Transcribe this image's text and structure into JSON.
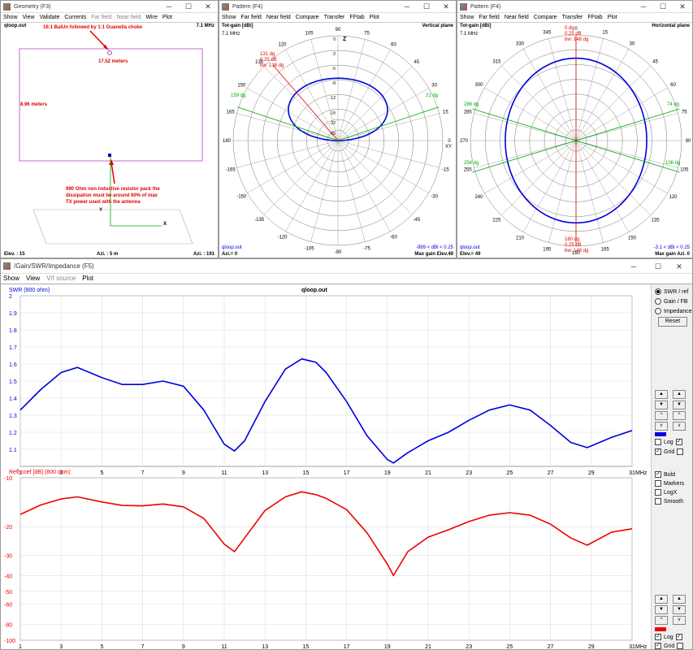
{
  "geom": {
    "title": "Geometry   (F3)",
    "menu": [
      "Show",
      "View",
      "Validate",
      "Currents",
      "Far field",
      "Near field",
      "Wire",
      "Plot"
    ],
    "file": "qloop.out",
    "freq": "7.1 MHz",
    "balun": "16:1 BalUn followed by 1:1 Guanella choke",
    "width": "17.52 meters",
    "height": "8.96 meters",
    "note1": "990 Ohm non inductive resistor pack the",
    "note2": "dissipation must be around 60% of max",
    "note3": "TX power used with the antenna",
    "elev": "Elev. : 15",
    "azi_mid": "Azi. : 5 m",
    "azi": "Azi. : 191",
    "ax_y": "Y",
    "ax_x": "X",
    "ax_z": "Z"
  },
  "pv": {
    "title": "Pattern   (F4)",
    "menu": [
      "Show",
      "Far field",
      "Near field",
      "Compare",
      "Transfer",
      "FFtab",
      "Plot"
    ],
    "gain": "Tot-gain [dBi]",
    "freq": "7.1 MHz",
    "plane": "Vertical plane",
    "file": "qloop.out",
    "azi": "Azi.= 0",
    "range": "-999 < dBi < 0.25",
    "maxg": "Max gain Elev.49",
    "zl": "Z",
    "xy": "XY",
    "ang": [
      "90",
      "60",
      "30",
      "0",
      "-30",
      "-60",
      "-90",
      "-120",
      "-150",
      "180",
      "150",
      "120"
    ],
    "ang2": [
      "75",
      "45",
      "15",
      "-15",
      "-45",
      "-75",
      "-105",
      "-135",
      "-165",
      "165",
      "135",
      "105"
    ],
    "lab1": "131 dg",
    "lab2": "0.25 dB",
    "lab3": "bw: 138 dg",
    "lab4": "159 dg",
    "lab5": "21 dg",
    "rings": [
      "0",
      "-2",
      "-5",
      "-8",
      "-12",
      "-16",
      "-22",
      "-35"
    ]
  },
  "ph": {
    "title": "Pattern   (F4)",
    "menu": [
      "Show",
      "Far field",
      "Near field",
      "Compare",
      "Transfer",
      "FFtab",
      "Plot"
    ],
    "gain": "Tot-gain [dBi]",
    "freq": "7.1 MHz",
    "plane": "Horizontal plane",
    "file": "qloop.out",
    "elev": "Elev.= 49",
    "range": "-3.1 < dBi < 0.25",
    "maxg": "Max gain Azi. 0",
    "ang": [
      "0",
      "30",
      "60",
      "90",
      "120",
      "150",
      "180",
      "210",
      "240",
      "270",
      "300",
      "330"
    ],
    "ang2": [
      "15",
      "45",
      "75",
      "105",
      "135",
      "165",
      "195",
      "225",
      "255",
      "285",
      "315",
      "345"
    ],
    "lab1": "0 dg",
    "lab2": "0.25 dB",
    "lab3": "bw: 148 dg",
    "lab4": "286 dg",
    "lab5": "74 dg",
    "lab6": "254 dg",
    "lab7": "106 dg",
    "lab8": "180 dg",
    "lab9": "0.25 dB",
    "lab10": "bw: 148 dg"
  },
  "swr": {
    "title": "/Gain/SWR/Impedance (F5)",
    "menu": [
      "Show",
      "View",
      "V/I source",
      "Plot"
    ],
    "file": "qloop.out",
    "ylabel": "SWR (800 ohm)",
    "mhz": "MHz",
    "radio": [
      "SWR / ref",
      "Gain / FB",
      "Impedance"
    ],
    "reset": "Reset",
    "log": "Log",
    "grid": "Grid",
    "bold": "Bold",
    "markers": "Markers",
    "logx": "LogX",
    "smooth": "Smooth",
    "rlabel": "Refl coef [dB] (800 ohm)"
  },
  "chart_data": [
    {
      "type": "line",
      "ylabel": "SWR (800 ohm)",
      "title": "qloop.out",
      "xlabel": "MHz",
      "ylim": [
        1,
        2
      ],
      "x_ticks": [
        1,
        3,
        5,
        7,
        9,
        11,
        13,
        15,
        17,
        19,
        21,
        23,
        25,
        27,
        29,
        31
      ],
      "y_ticks": [
        "2",
        "1.9",
        "1.8",
        "1.7",
        "1.6",
        "1.5",
        "1.4",
        "1.3",
        "1.2",
        "1.1"
      ],
      "series": [
        {
          "color": "#0000dd",
          "x": [
            1,
            2,
            3,
            3.8,
            5,
            6,
            7,
            8,
            9,
            10,
            11,
            11.5,
            12,
            13,
            14,
            14.8,
            15.5,
            16,
            17,
            18,
            19,
            19.3,
            20,
            21,
            22,
            23,
            24,
            25,
            26,
            27,
            28,
            28.8,
            30,
            31
          ],
          "y": [
            1.33,
            1.45,
            1.55,
            1.58,
            1.52,
            1.48,
            1.48,
            1.5,
            1.47,
            1.33,
            1.13,
            1.09,
            1.15,
            1.38,
            1.57,
            1.63,
            1.61,
            1.55,
            1.38,
            1.18,
            1.04,
            1.02,
            1.08,
            1.15,
            1.2,
            1.27,
            1.33,
            1.36,
            1.33,
            1.24,
            1.14,
            1.11,
            1.17,
            1.21
          ]
        }
      ]
    },
    {
      "type": "line",
      "ylabel": "Refl coef [dB] (800 ohm)",
      "xlabel": "MHz",
      "ylim": [
        -100,
        -10
      ],
      "log": true,
      "x_ticks": [
        1,
        3,
        5,
        7,
        9,
        11,
        13,
        15,
        17,
        19,
        21,
        23,
        25,
        27,
        29,
        31
      ],
      "y_ticks": [
        "-10",
        "-20",
        "-30",
        "-40",
        "-50",
        "-60",
        "-80",
        "-100"
      ],
      "series": [
        {
          "color": "#ee0000",
          "x": [
            1,
            2,
            3,
            3.8,
            5,
            6,
            7,
            8,
            9,
            10,
            11,
            11.5,
            12,
            13,
            14,
            14.8,
            15.5,
            16,
            17,
            18,
            19,
            19.3,
            20,
            21,
            22,
            23,
            24,
            25,
            26,
            27,
            28,
            28.8,
            30,
            31
          ],
          "y": [
            -16.8,
            -14.7,
            -13.5,
            -13.1,
            -14.1,
            -14.8,
            -14.9,
            -14.5,
            -15.1,
            -17.8,
            -25.6,
            -28.5,
            -23.5,
            -15.9,
            -13.1,
            -12.2,
            -12.7,
            -13.4,
            -15.7,
            -21.8,
            -34,
            -40,
            -28.5,
            -23.2,
            -20.9,
            -18.6,
            -17,
            -16.4,
            -17,
            -19.3,
            -23.5,
            -26,
            -21.6,
            -20.6
          ]
        }
      ]
    }
  ]
}
